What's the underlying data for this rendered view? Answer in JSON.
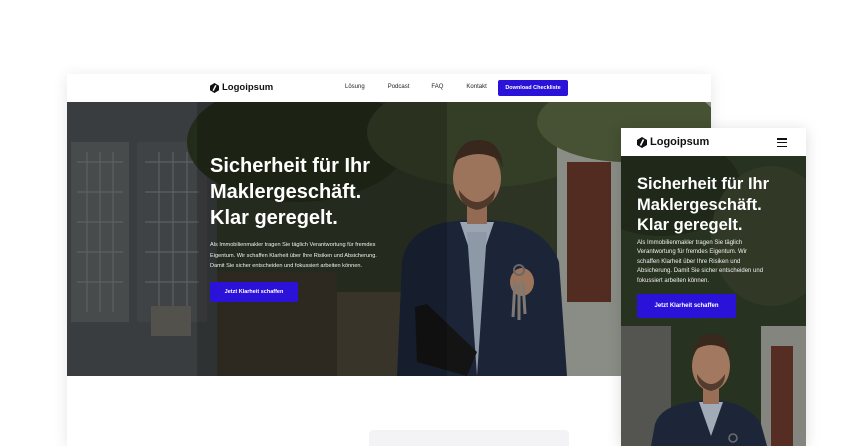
{
  "brand": {
    "name": "Logoipsum",
    "accent": "#2b12d9"
  },
  "desktop": {
    "nav": {
      "links": [
        "Lösung",
        "Podcast",
        "FAQ",
        "Kontakt"
      ],
      "cta_label": "Download Checkliste"
    },
    "hero": {
      "title_lines": [
        "Sicherheit für Ihr",
        "Maklergeschäft.",
        "Klar geregelt."
      ],
      "body_lines": [
        "Als Immobilienmakler tragen Sie täglich Verantwortung für fremdes",
        "Eigentum. Wir schaffen Klarheit über Ihre Risiken und Absicherung.",
        "Damit Sie sicher entscheiden und fokussiert arbeiten können."
      ],
      "button_label": "Jetzt Klarheit schaffen"
    }
  },
  "mobile": {
    "nav": {
      "menu_icon": "hamburger-icon"
    },
    "hero": {
      "title_lines": [
        "Sicherheit für Ihr",
        "Maklergeschäft.",
        "Klar geregelt."
      ],
      "body_lines": [
        "Als Immobilienmakler tragen Sie täglich",
        "Verantwortung für fremdes Eigentum. Wir",
        "schaffen Klarheit über Ihre Risiken und",
        "Absicherung. Damit Sie sicher entscheiden und",
        "fokussiert arbeiten können."
      ],
      "button_label": "Jetzt Klarheit schaffen"
    }
  }
}
